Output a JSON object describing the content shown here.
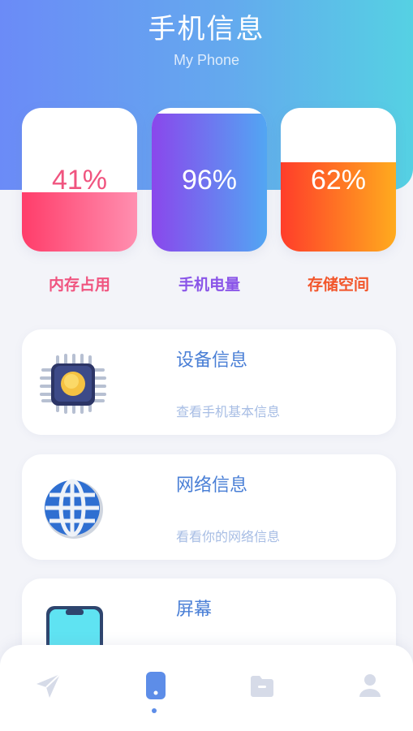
{
  "header": {
    "title": "手机信息",
    "subtitle": "My Phone"
  },
  "stats": [
    {
      "label": "内存占用",
      "value": "41%",
      "fill": 0.41,
      "color": "#f0547f"
    },
    {
      "label": "手机电量",
      "value": "96%",
      "fill": 0.96,
      "color": "#8a55e8"
    },
    {
      "label": "存储空间",
      "value": "62%",
      "fill": 0.62,
      "color": "#f2552a"
    }
  ],
  "cards": [
    {
      "title": "设备信息",
      "desc": "查看手机基本信息",
      "icon": "cpu-chip-icon"
    },
    {
      "title": "网络信息",
      "desc": "看看你的网络信息",
      "icon": "globe-icon"
    },
    {
      "title": "屏幕",
      "desc": "",
      "icon": "phone-screen-icon"
    }
  ],
  "nav": [
    {
      "icon": "paper-plane-icon",
      "active": false
    },
    {
      "icon": "phone-icon",
      "active": true
    },
    {
      "icon": "folder-icon",
      "active": false
    },
    {
      "icon": "user-icon",
      "active": false
    }
  ],
  "colors": {
    "accent": "#5d8de8",
    "nav_inactive": "#d6dbe8",
    "card_title": "#4a7fd6",
    "card_desc": "#a7bde4"
  }
}
